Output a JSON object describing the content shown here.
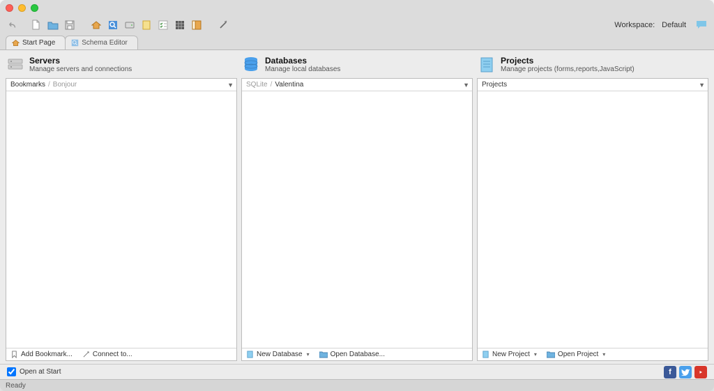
{
  "workspace": {
    "label": "Workspace:",
    "value": "Default"
  },
  "tabs": [
    {
      "label": "Start Page",
      "icon": "home"
    },
    {
      "label": "Schema Editor",
      "icon": "search"
    }
  ],
  "columns": {
    "servers": {
      "title": "Servers",
      "subtitle": "Manage servers and connections",
      "tabs": {
        "primary": "Bookmarks",
        "secondary": "Bonjour"
      },
      "footer": {
        "add": "Add Bookmark...",
        "connect": "Connect to..."
      }
    },
    "databases": {
      "title": "Databases",
      "subtitle": "Manage local databases",
      "tabs": {
        "primary": "SQLite",
        "secondary": "Valentina"
      },
      "footer": {
        "new": "New Database",
        "open": "Open Database..."
      }
    },
    "projects": {
      "title": "Projects",
      "subtitle": "Manage projects (forms,reports,JavaScript)",
      "tabs": {
        "primary": "Projects"
      },
      "footer": {
        "new": "New Project",
        "open": "Open Project"
      }
    }
  },
  "open_at_start": "Open at Start",
  "status": "Ready",
  "toolbar_icons": [
    "undo",
    "file-new",
    "folder",
    "save",
    "spacer",
    "home",
    "search",
    "disk",
    "new-page",
    "checklist",
    "grid",
    "sidebar",
    "spacer",
    "wand"
  ]
}
